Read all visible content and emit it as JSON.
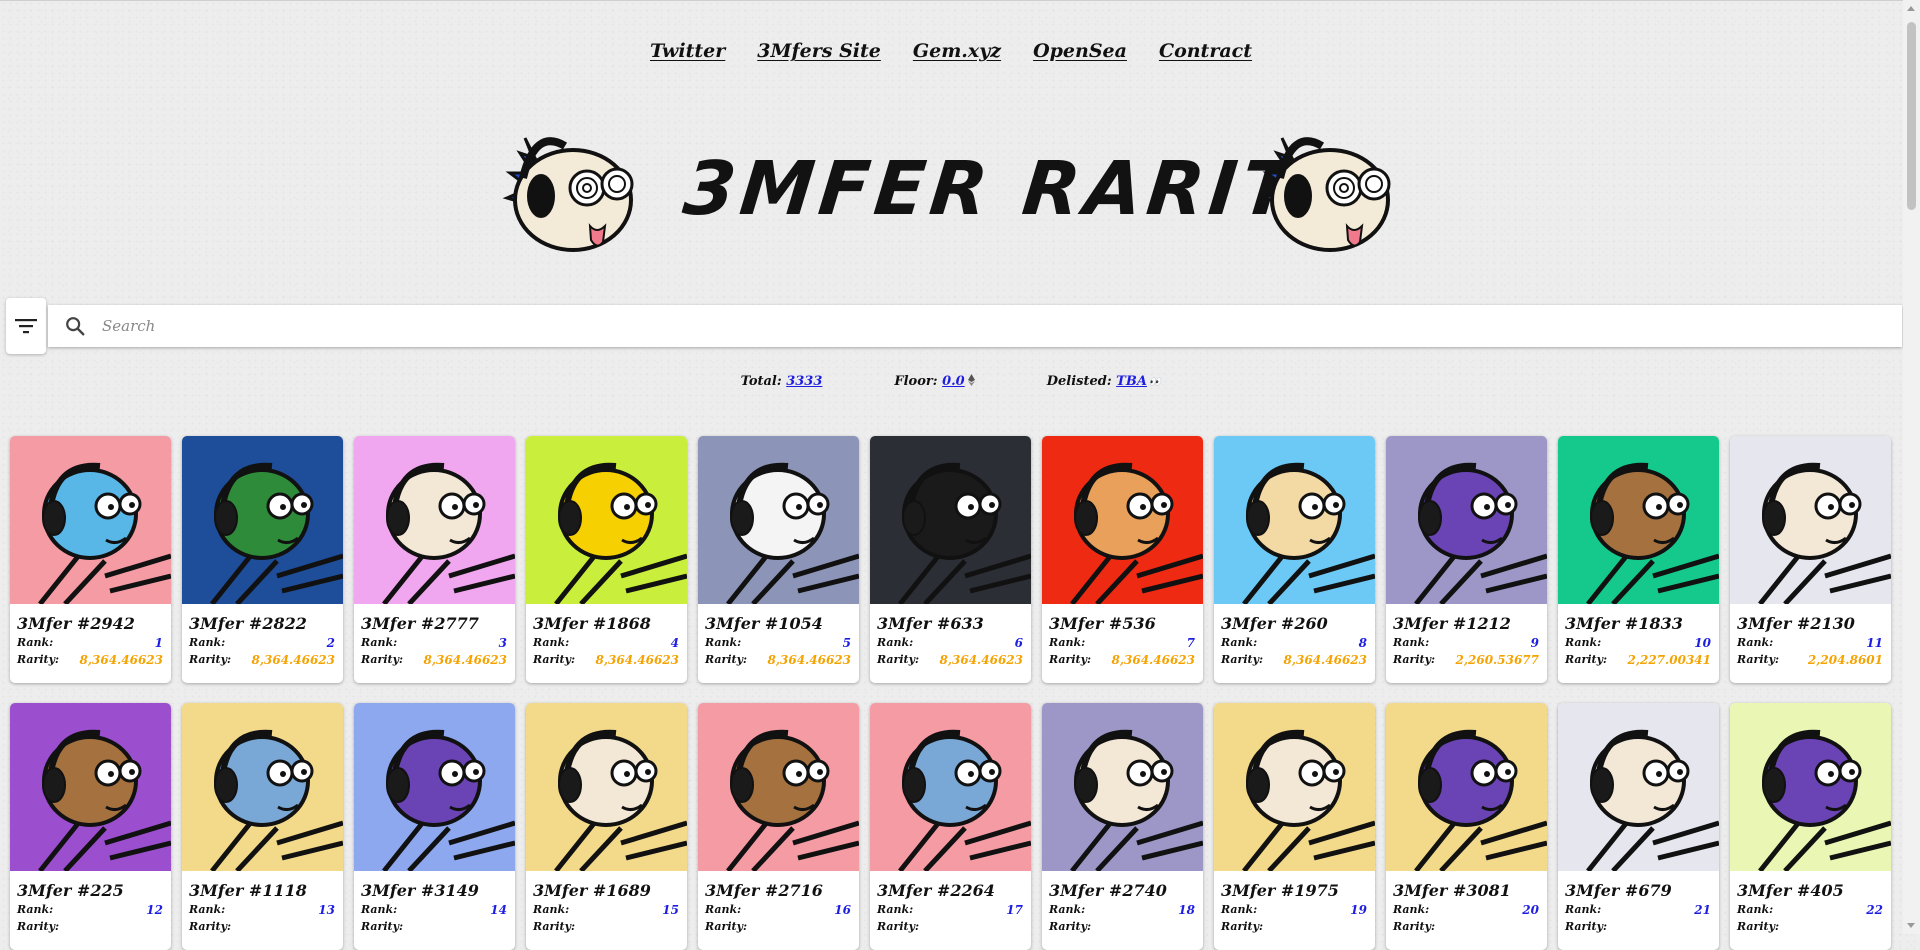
{
  "nav": {
    "links": [
      {
        "label": "Twitter"
      },
      {
        "label": "3Mfers Site"
      },
      {
        "label": "Gem.xyz"
      },
      {
        "label": "OpenSea"
      },
      {
        "label": "Contract"
      }
    ]
  },
  "hero": {
    "title": "3MFER RARITY"
  },
  "search": {
    "placeholder": "Search",
    "value": ""
  },
  "stats": {
    "total_label": "Total:",
    "total_value": "3333",
    "floor_label": "Floor:",
    "floor_value": "0.0",
    "delisted_label": "Delisted:",
    "delisted_value": "TBA",
    "delisted_emoji": "👀"
  },
  "labels": {
    "rank": "Rank:",
    "rarity": "Rarity:"
  },
  "colors": {
    "rank": "#1e1ee0",
    "rarity": "#f5a300"
  },
  "cards": [
    {
      "name": "3Mfer #2942",
      "rank": "1",
      "rarity": "8,364.46623",
      "bg": "#f49ba4",
      "skin": "#59b7e8",
      "head": "cat"
    },
    {
      "name": "3Mfer #2822",
      "rank": "2",
      "rarity": "8,364.46623",
      "bg": "#1e4d9a",
      "skin": "#2e8b3a",
      "head": "zombie"
    },
    {
      "name": "3Mfer #2777",
      "rank": "3",
      "rarity": "8,364.46623",
      "bg": "#f1a7ef",
      "skin": "#f3e7d6",
      "head": "rainbow"
    },
    {
      "name": "3Mfer #1868",
      "rank": "4",
      "rarity": "8,364.46623",
      "bg": "#c9ef3c",
      "skin": "#f6d000",
      "head": "yellow"
    },
    {
      "name": "3Mfer #1054",
      "rank": "5",
      "rarity": "8,364.46623",
      "bg": "#8c95b8",
      "skin": "#f4f4f4",
      "head": "skull"
    },
    {
      "name": "3Mfer #633",
      "rank": "6",
      "rarity": "8,364.46623",
      "bg": "#2b2e35",
      "skin": "#1a1a1a",
      "head": "bat"
    },
    {
      "name": "3Mfer #536",
      "rank": "7",
      "rarity": "8,364.46623",
      "bg": "#ef2a12",
      "skin": "#e8a05a",
      "head": "round"
    },
    {
      "name": "3Mfer #260",
      "rank": "8",
      "rarity": "8,364.46623",
      "bg": "#6cc9f6",
      "skin": "#f3d9a4",
      "head": "cool"
    },
    {
      "name": "3Mfer #1212",
      "rank": "9",
      "rarity": "2,260.53677",
      "bg": "#9c97c6",
      "skin": "#6a44b5",
      "head": "round"
    },
    {
      "name": "3Mfer #1833",
      "rank": "10",
      "rarity": "2,227.00341",
      "bg": "#15c98d",
      "skin": "#a5713f",
      "head": "round"
    },
    {
      "name": "3Mfer #2130",
      "rank": "11",
      "rarity": "2,204.8601",
      "bg": "#e6e6ee",
      "skin": "#f3e7d6",
      "head": "round"
    },
    {
      "name": "3Mfer #225",
      "rank": "12",
      "rarity": "",
      "bg": "#9b4fcf",
      "skin": "#a5713f",
      "head": "round"
    },
    {
      "name": "3Mfer #1118",
      "rank": "13",
      "rarity": "",
      "bg": "#f3d98a",
      "skin": "#7aa8d6",
      "head": "round"
    },
    {
      "name": "3Mfer #3149",
      "rank": "14",
      "rarity": "",
      "bg": "#8ea8ef",
      "skin": "#6a44b5",
      "head": "round"
    },
    {
      "name": "3Mfer #1689",
      "rank": "15",
      "rarity": "",
      "bg": "#f3d98a",
      "skin": "#f3e7d6",
      "head": "round"
    },
    {
      "name": "3Mfer #2716",
      "rank": "16",
      "rarity": "",
      "bg": "#f49ba4",
      "skin": "#a5713f",
      "head": "round"
    },
    {
      "name": "3Mfer #2264",
      "rank": "17",
      "rarity": "",
      "bg": "#f49ba4",
      "skin": "#7aa8d6",
      "head": "round"
    },
    {
      "name": "3Mfer #2740",
      "rank": "18",
      "rarity": "",
      "bg": "#9c97c6",
      "skin": "#f3e7d6",
      "head": "round"
    },
    {
      "name": "3Mfer #1975",
      "rank": "19",
      "rarity": "",
      "bg": "#f3d98a",
      "skin": "#f3e7d6",
      "head": "round"
    },
    {
      "name": "3Mfer #3081",
      "rank": "20",
      "rarity": "",
      "bg": "#f3d98a",
      "skin": "#6a44b5",
      "head": "round"
    },
    {
      "name": "3Mfer #679",
      "rank": "21",
      "rarity": "",
      "bg": "#e6e6ee",
      "skin": "#f3e7d6",
      "head": "round"
    },
    {
      "name": "3Mfer #405",
      "rank": "22",
      "rarity": "",
      "bg": "#eaf7b4",
      "skin": "#6a44b5",
      "head": "round"
    }
  ]
}
